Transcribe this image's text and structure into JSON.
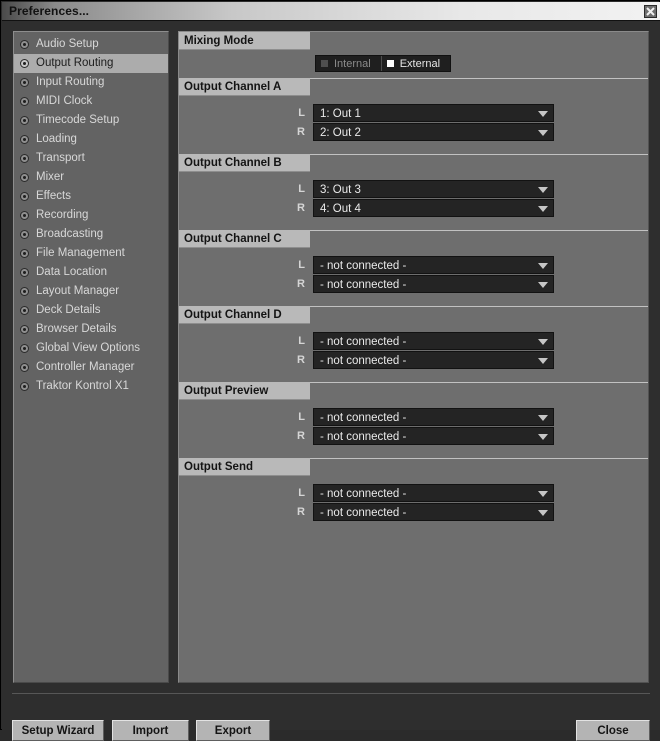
{
  "window": {
    "title": "Preferences...",
    "close_icon": "close-x-icon"
  },
  "sidebar": {
    "items": [
      {
        "label": "Audio Setup",
        "selected": false
      },
      {
        "label": "Output Routing",
        "selected": true
      },
      {
        "label": "Input Routing",
        "selected": false
      },
      {
        "label": "MIDI Clock",
        "selected": false
      },
      {
        "label": "Timecode Setup",
        "selected": false
      },
      {
        "label": "Loading",
        "selected": false
      },
      {
        "label": "Transport",
        "selected": false
      },
      {
        "label": "Mixer",
        "selected": false
      },
      {
        "label": "Effects",
        "selected": false
      },
      {
        "label": "Recording",
        "selected": false
      },
      {
        "label": "Broadcasting",
        "selected": false
      },
      {
        "label": "File Management",
        "selected": false
      },
      {
        "label": "Data Location",
        "selected": false
      },
      {
        "label": "Layout Manager",
        "selected": false
      },
      {
        "label": "Deck Details",
        "selected": false
      },
      {
        "label": "Browser Details",
        "selected": false
      },
      {
        "label": "Global View Options",
        "selected": false
      },
      {
        "label": "Controller Manager",
        "selected": false
      },
      {
        "label": "Traktor Kontrol X1",
        "selected": false
      }
    ]
  },
  "panel": {
    "mixing_mode": {
      "header": "Mixing Mode",
      "options": [
        {
          "label": "Internal",
          "selected": false
        },
        {
          "label": "External",
          "selected": true
        }
      ]
    },
    "sections": [
      {
        "header": "Output Channel A",
        "rows": [
          {
            "channel": "L",
            "value": "1: Out 1"
          },
          {
            "channel": "R",
            "value": "2: Out 2"
          }
        ]
      },
      {
        "header": "Output Channel B",
        "rows": [
          {
            "channel": "L",
            "value": "3: Out 3"
          },
          {
            "channel": "R",
            "value": "4: Out 4"
          }
        ]
      },
      {
        "header": "Output Channel C",
        "rows": [
          {
            "channel": "L",
            "value": "- not connected -"
          },
          {
            "channel": "R",
            "value": "- not connected -"
          }
        ]
      },
      {
        "header": "Output Channel D",
        "rows": [
          {
            "channel": "L",
            "value": "- not connected -"
          },
          {
            "channel": "R",
            "value": "- not connected -"
          }
        ]
      },
      {
        "header": "Output Preview",
        "rows": [
          {
            "channel": "L",
            "value": "- not connected -"
          },
          {
            "channel": "R",
            "value": "- not connected -"
          }
        ]
      },
      {
        "header": "Output Send",
        "rows": [
          {
            "channel": "L",
            "value": "- not connected -"
          },
          {
            "channel": "R",
            "value": "- not connected -"
          }
        ]
      }
    ]
  },
  "footer": {
    "setup_wizard": "Setup Wizard",
    "import": "Import",
    "export": "Export",
    "close": "Close"
  },
  "colors": {
    "window_bg": "#2e2e2e",
    "sidebar_bg": "#636363",
    "panel_bg": "#6e6e6e",
    "section_header_bg": "#b9b9b9",
    "select_bg": "#242424",
    "selected_nav_bg": "#acacac",
    "toggle_on_swatch": "#ffffff",
    "button_bg": "#b4b4b4"
  }
}
